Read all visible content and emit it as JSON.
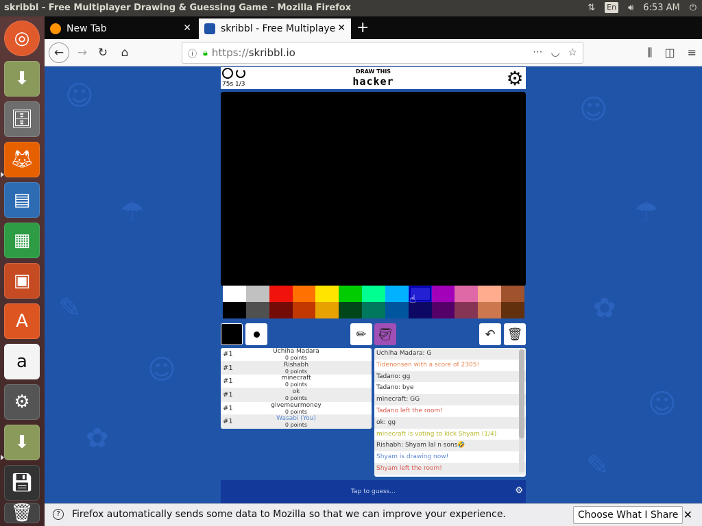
{
  "os_bar": {
    "window_title": "skribbl - Free Multiplayer Drawing & Guessing Game - Mozilla Firefox",
    "keyboard_layout": "En",
    "time": "6:53 AM"
  },
  "launcher": {
    "items": [
      "ubuntu-dash",
      "disk-installer",
      "file-manager",
      "firefox",
      "libreoffice-writer",
      "libreoffice-calc",
      "libreoffice-impress",
      "software-center",
      "amazon",
      "system-settings",
      "disk-installer-2",
      "floppy-save",
      "trash"
    ]
  },
  "browser": {
    "tabs": [
      {
        "label": "New Tab",
        "active": false
      },
      {
        "label": "skribbl - Free Multiplaye",
        "active": true
      }
    ],
    "url_protocol": "https://",
    "url_host": "skribbl.io"
  },
  "game": {
    "timer": "75s",
    "round": "1/3",
    "draw_this_label": "DRAW THIS",
    "word": "hacker",
    "palette": {
      "top": [
        "#ffffff",
        "#c1c1c1",
        "#ef130b",
        "#ff7100",
        "#ffe400",
        "#00cc00",
        "#00ff91",
        "#00b2ff",
        "#231fd3",
        "#a300ba",
        "#df69a7",
        "#ffac8e",
        "#a0522d"
      ],
      "bottom": [
        "#000000",
        "#505050",
        "#740b07",
        "#c23800",
        "#e8a200",
        "#004619",
        "#00785d",
        "#00569e",
        "#0e0865",
        "#550069",
        "#873554",
        "#cc774d",
        "#63300d"
      ],
      "selected": "#231fd3"
    },
    "players": [
      {
        "rank": "#1",
        "name": "Uchiha Madara",
        "points": "0 points",
        "you": false
      },
      {
        "rank": "#1",
        "name": "Rishabh",
        "points": "0 points",
        "you": false
      },
      {
        "rank": "#1",
        "name": "minecraft",
        "points": "0 points",
        "you": false
      },
      {
        "rank": "#1",
        "name": "ok",
        "points": "0 points",
        "you": false
      },
      {
        "rank": "#1",
        "name": "givemeurmoney",
        "points": "0 points",
        "you": false
      },
      {
        "rank": "#1",
        "name": "Wasabi (You)",
        "points": "0 points",
        "you": true
      }
    ],
    "chat": [
      {
        "text": "Uchiha Madara: G",
        "style": ""
      },
      {
        "text": "Tidenonsen with a score of 2305!",
        "style": "sys-orange"
      },
      {
        "text": "Tadano: gg",
        "style": ""
      },
      {
        "text": "Tadano: bye",
        "style": ""
      },
      {
        "text": "minecraft: GG",
        "style": ""
      },
      {
        "text": "Tadano left the room!",
        "style": "sys-red"
      },
      {
        "text": "ok: gg",
        "style": ""
      },
      {
        "text": "minecraft is voting to kick Shyam (1/4)",
        "style": "sys-green"
      },
      {
        "text": "Rishabh: Shyam lal n sons🤣",
        "style": ""
      },
      {
        "text": "Shyam is drawing now!",
        "style": "sys-blue"
      },
      {
        "text": "Shyam left the room!",
        "style": "sys-red"
      }
    ],
    "guess_placeholder": "Tap to guess..."
  },
  "notification": {
    "message": "Firefox automatically sends some data to Mozilla so that we can improve your experience.",
    "button": "Choose What I Share"
  }
}
